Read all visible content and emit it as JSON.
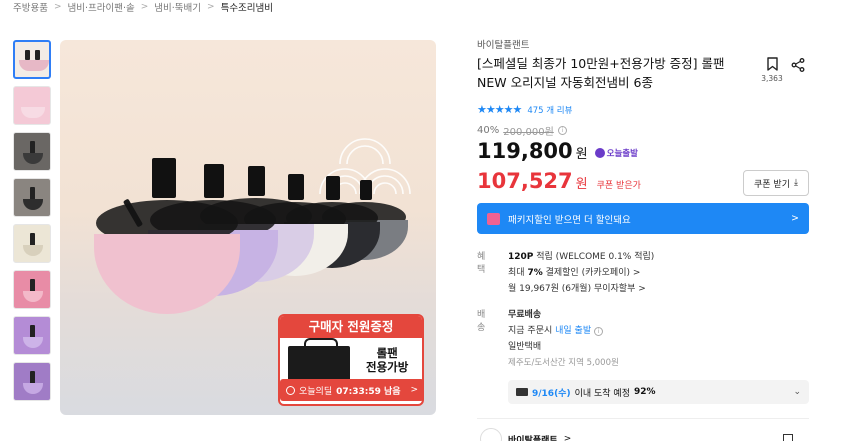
{
  "breadcrumb": [
    "주방용품",
    "냄비·프라이팬·솥",
    "냄비·뚝배기",
    "특수조리냄비"
  ],
  "promo": {
    "head": "구매자 전원증정",
    "title_line1": "롤팬",
    "title_line2": "전용가방",
    "timer_label": "오늘의딜",
    "timer_value": "07:33:59 남음"
  },
  "product": {
    "brand": "바이탈플랜트",
    "title": "[스페셜딜 최종가 10만원+전용가방 증정] 롤팬 NEW 오리지널 자동회전냄비 6종",
    "bookmark_count": "3,363",
    "rating": 5,
    "reviews": "475 개 리뷰",
    "discount_rate": "40%",
    "original_price": "200,000원",
    "price": "119,800",
    "price_unit": "원",
    "delivery_badge": "오늘출발",
    "coupon_price": "107,527",
    "coupon_price_unit": "원",
    "coupon_label": "쿠폰 받은가",
    "coupon_button": "쿠폰 받기"
  },
  "package_banner": "패키지할인 받으면 더 할인돼요",
  "benefit": {
    "label": "혜택",
    "points": "120P",
    "points_text": "적립 (WELCOME 0.1% 적립)",
    "card_prefix": "최대",
    "card_rate": "7%",
    "card_text": "결제할인 (카카오페이)",
    "installment": "월 19,967원 (6개월) 무이자할부"
  },
  "shipping": {
    "label": "배송",
    "free": "무료배송",
    "order_now": "지금 주문시",
    "tomorrow": "내일 출발",
    "type": "일반택배",
    "extra": "제주도/도서산간 지역 5,000원"
  },
  "arrival": {
    "date": "9/16(수)",
    "text": "이내 도착 예정",
    "pct": "92%"
  },
  "seller": {
    "name": "바이탈플랜트"
  },
  "colors": {
    "accent": "#1e88f5",
    "sale": "#e8353b",
    "promo": "#e4473d"
  }
}
